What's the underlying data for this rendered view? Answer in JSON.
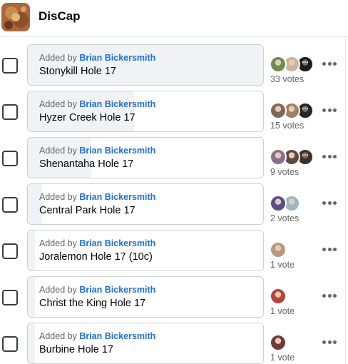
{
  "header": {
    "app_name": "DisCap",
    "logo_icon": "discap-app-logo-icon"
  },
  "colors": {
    "author_link": "#216fdb",
    "muted_text": "#65676b",
    "progress_fill": "#f0f2f5",
    "border": "#ced0d4"
  },
  "poll": {
    "options": [
      {
        "added_prefix": "Added by",
        "author": "Brian Bickersmith",
        "name": "Stonykill Hole 17",
        "votes_label": "33 votes",
        "fill_fraction": 1.0,
        "avatar_colors": [
          "#6f8b55",
          "#c9b79a",
          "#2d3530"
        ],
        "more_indicator": "···"
      },
      {
        "added_prefix": "Added by",
        "author": "Brian Bickersmith",
        "name": "Hyzer Creek Hole 17",
        "votes_label": "15 votes",
        "fill_fraction": 0.45,
        "avatar_colors": [
          "#7b6a5a",
          "#a08067",
          "#3f4a44"
        ],
        "more_indicator": "···"
      },
      {
        "added_prefix": "Added by",
        "author": "Brian Bickersmith",
        "name": "Shenantaha Hole 17",
        "votes_label": "9 votes",
        "fill_fraction": 0.27,
        "avatar_colors": [
          "#8a6f8f",
          "#5c4a3e",
          "#6e5b4b"
        ],
        "more_indicator": "···"
      },
      {
        "added_prefix": "Added by",
        "author": "Brian Bickersmith",
        "name": "Central Park Hole 17",
        "votes_label": "2 votes",
        "fill_fraction": 0.06,
        "avatar_colors": [
          "#5a4e8c",
          "#9bb8c9"
        ],
        "more_indicator": ""
      },
      {
        "added_prefix": "Added by",
        "author": "Brian Bickersmith",
        "name": "Joralemon Hole 17 (10c)",
        "votes_label": "1 vote",
        "fill_fraction": 0.03,
        "avatar_colors": [
          "#b59a80"
        ],
        "more_indicator": ""
      },
      {
        "added_prefix": "Added by",
        "author": "Brian Bickersmith",
        "name": "Christ the King Hole 17",
        "votes_label": "1 vote",
        "fill_fraction": 0.03,
        "avatar_colors": [
          "#b5463f"
        ],
        "more_indicator": ""
      },
      {
        "added_prefix": "Added by",
        "author": "Brian Bickersmith",
        "name": "Burbine Hole 17",
        "votes_label": "1 vote",
        "fill_fraction": 0.03,
        "avatar_colors": [
          "#6e3b3a"
        ],
        "more_indicator": ""
      }
    ]
  }
}
